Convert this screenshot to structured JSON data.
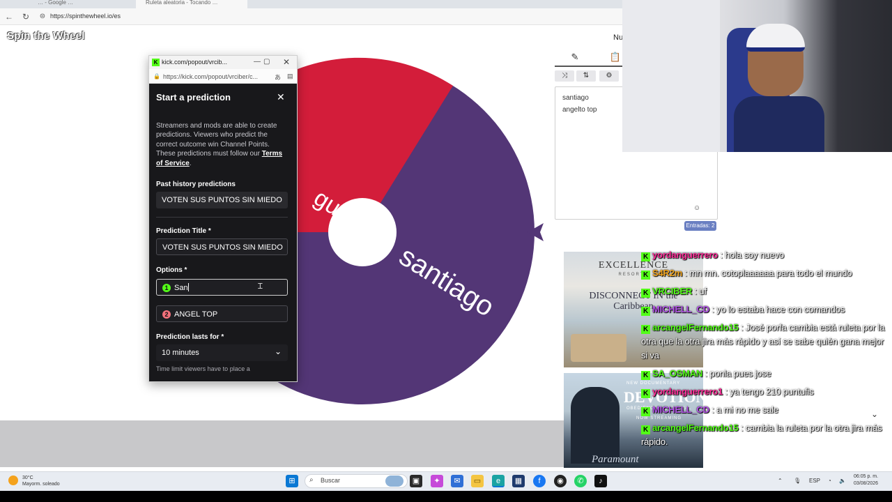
{
  "browser": {
    "url": "https://spinthewheel.io/es",
    "tabs": [
      "… - Google …",
      "Ruleta aleatoria - Tocando …"
    ]
  },
  "page": {
    "brand": "Spin the Wheel",
    "nav_partial": "Nu"
  },
  "wheel": {
    "segments": [
      {
        "label": "angelto top",
        "visible_fragment": "gue",
        "color": "#d31d3a"
      },
      {
        "label": "santiago",
        "color": "#533676"
      }
    ]
  },
  "entries_panel": {
    "entries": [
      "santiago",
      "angelto top"
    ],
    "emoji_button": "☺",
    "count_badge": "Entradas: 2"
  },
  "popup": {
    "window_title": "kick.com/popout/vrcib...",
    "url": "https://kick.com/popout/vrciber/c...",
    "heading": "Start a prediction",
    "description": "Streamers and mods are able to create predictions. Viewers who predict the correct outcome win Channel Points. These predictions must follow our",
    "tos_link": "Terms of Service",
    "tos_suffix": ".",
    "past_history_label": "Past history predictions",
    "past_history_value": "VOTEN SUS PUNTOS SIN MIEDO",
    "title_label": "Prediction Title *",
    "title_value": "VOTEN SUS PUNTOS SIN MIEDO",
    "options_label": "Options *",
    "options": [
      {
        "num": "1",
        "value": "San",
        "color": "#53fc18"
      },
      {
        "num": "2",
        "value": "ANGEL TOP",
        "color": "#f2707b"
      }
    ],
    "duration_label": "Prediction lasts for *",
    "duration_value": "10 minutes",
    "duration_help": "Time limit viewers have to place a"
  },
  "chat": {
    "messages": [
      {
        "user": "yordanguerrero",
        "color": "#ff2e9a",
        "text": ": hola soy nuevo"
      },
      {
        "user": "S4R2m",
        "color": "#f1a51f",
        "text": ": mn mn. cotoplaaaaaa para todo el mundo"
      },
      {
        "user": "VRCIBER",
        "color": "#53fc18",
        "text": ": uf"
      },
      {
        "user": "MICHELL_CD",
        "color": "#b455e8",
        "text": ": yo lo estaba hace con comandos"
      },
      {
        "user": "arcangelFernando15",
        "color": "#53fc18",
        "text": ": José porfa cambia está ruleta por la otra que la otra jira más rápido y así se sabe quién gana mejor si va"
      },
      {
        "user": "SA_OSMAN",
        "color": "#53fc18",
        "text": ": ponla pues jose"
      },
      {
        "user": "yordanguerrero1",
        "color": "#ff2e9a",
        "text": ": ya tengo 210 puntufis"
      },
      {
        "user": "MICHELL_CD",
        "color": "#b455e8",
        "text": ": a mi no me sale"
      },
      {
        "user": "arcangelFernando15",
        "color": "#53fc18",
        "text": ": cambia la ruleta por la otra jira más rápido."
      }
    ]
  },
  "ads": {
    "ad1": {
      "title": "EXCELLENCE",
      "subtitle": "RESORTS",
      "tagline": "DISCONNECT IN the Caribbean"
    },
    "ad2": {
      "kicker": "NEW DOCUMENTARY",
      "title": "DEVOTION",
      "subtitle": "OBEDIENCE & BETRAYAL",
      "footer": "NOW STREAMING",
      "brand": "Paramount"
    }
  },
  "taskbar": {
    "weather_temp": "30°C",
    "weather_desc": "Mayorm. soleado",
    "search_placeholder": "Buscar",
    "lang": "ESP",
    "time": "06:05 p. m.",
    "date": "03/08/2026"
  }
}
